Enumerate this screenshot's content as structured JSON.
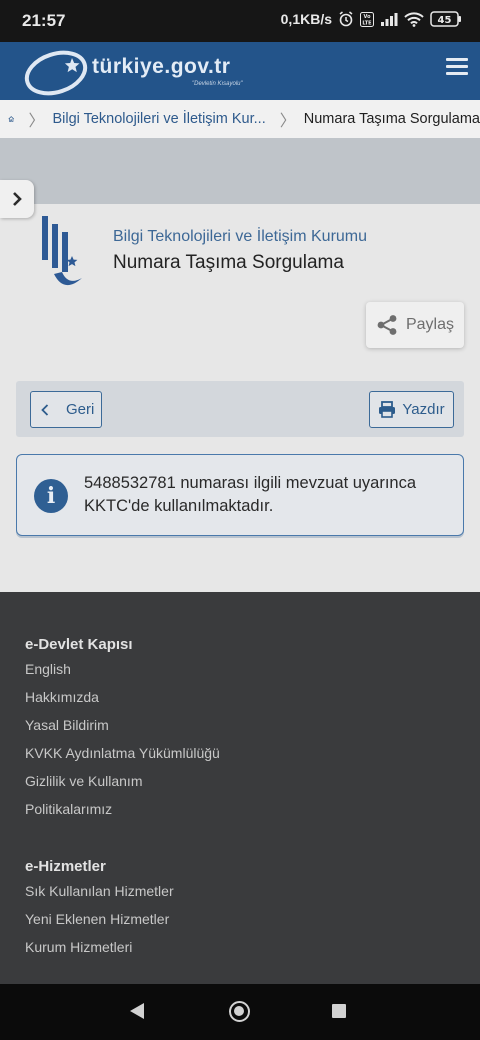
{
  "status_bar": {
    "time": "21:57",
    "net_speed": "0,1KB/s",
    "battery": "45",
    "volte": "Vo LTE"
  },
  "header": {
    "logo_text": "türkiye.gov.tr",
    "logo_tagline": "\"Devletin Kısayolu\""
  },
  "breadcrumb": {
    "link": "Bilgi Teknolojileri ve İletişim Kur...",
    "current": "Numara Taşıma Sorgulama"
  },
  "page": {
    "institution": "Bilgi Teknolojileri ve İletişim Kurumu",
    "title": "Numara Taşıma Sorgulama",
    "share_label": "Paylaş",
    "back_label": "Geri",
    "print_label": "Yazdır",
    "alert_icon": "i",
    "alert_text": "5488532781 numarası ilgili mevzuat uyarınca KKTC'de kullanılmaktadır."
  },
  "footer": {
    "section1_title": "e-Devlet Kapısı",
    "section1_links": [
      "English",
      "Hakkımızda",
      "Yasal Bildirim",
      "KVKK Aydınlatma Yükümlülüğü",
      "Gizlilik ve Kullanım",
      "Politikalarımız"
    ],
    "section2_title": "e-Hizmetler",
    "section2_links": [
      "Sık Kullanılan Hizmetler",
      "Yeni Eklenen Hizmetler",
      "Kurum Hizmetleri"
    ]
  },
  "colors": {
    "brand_blue": "#23548a",
    "link_blue": "#2e5a8c",
    "footer_bg": "#3a3b3d"
  }
}
